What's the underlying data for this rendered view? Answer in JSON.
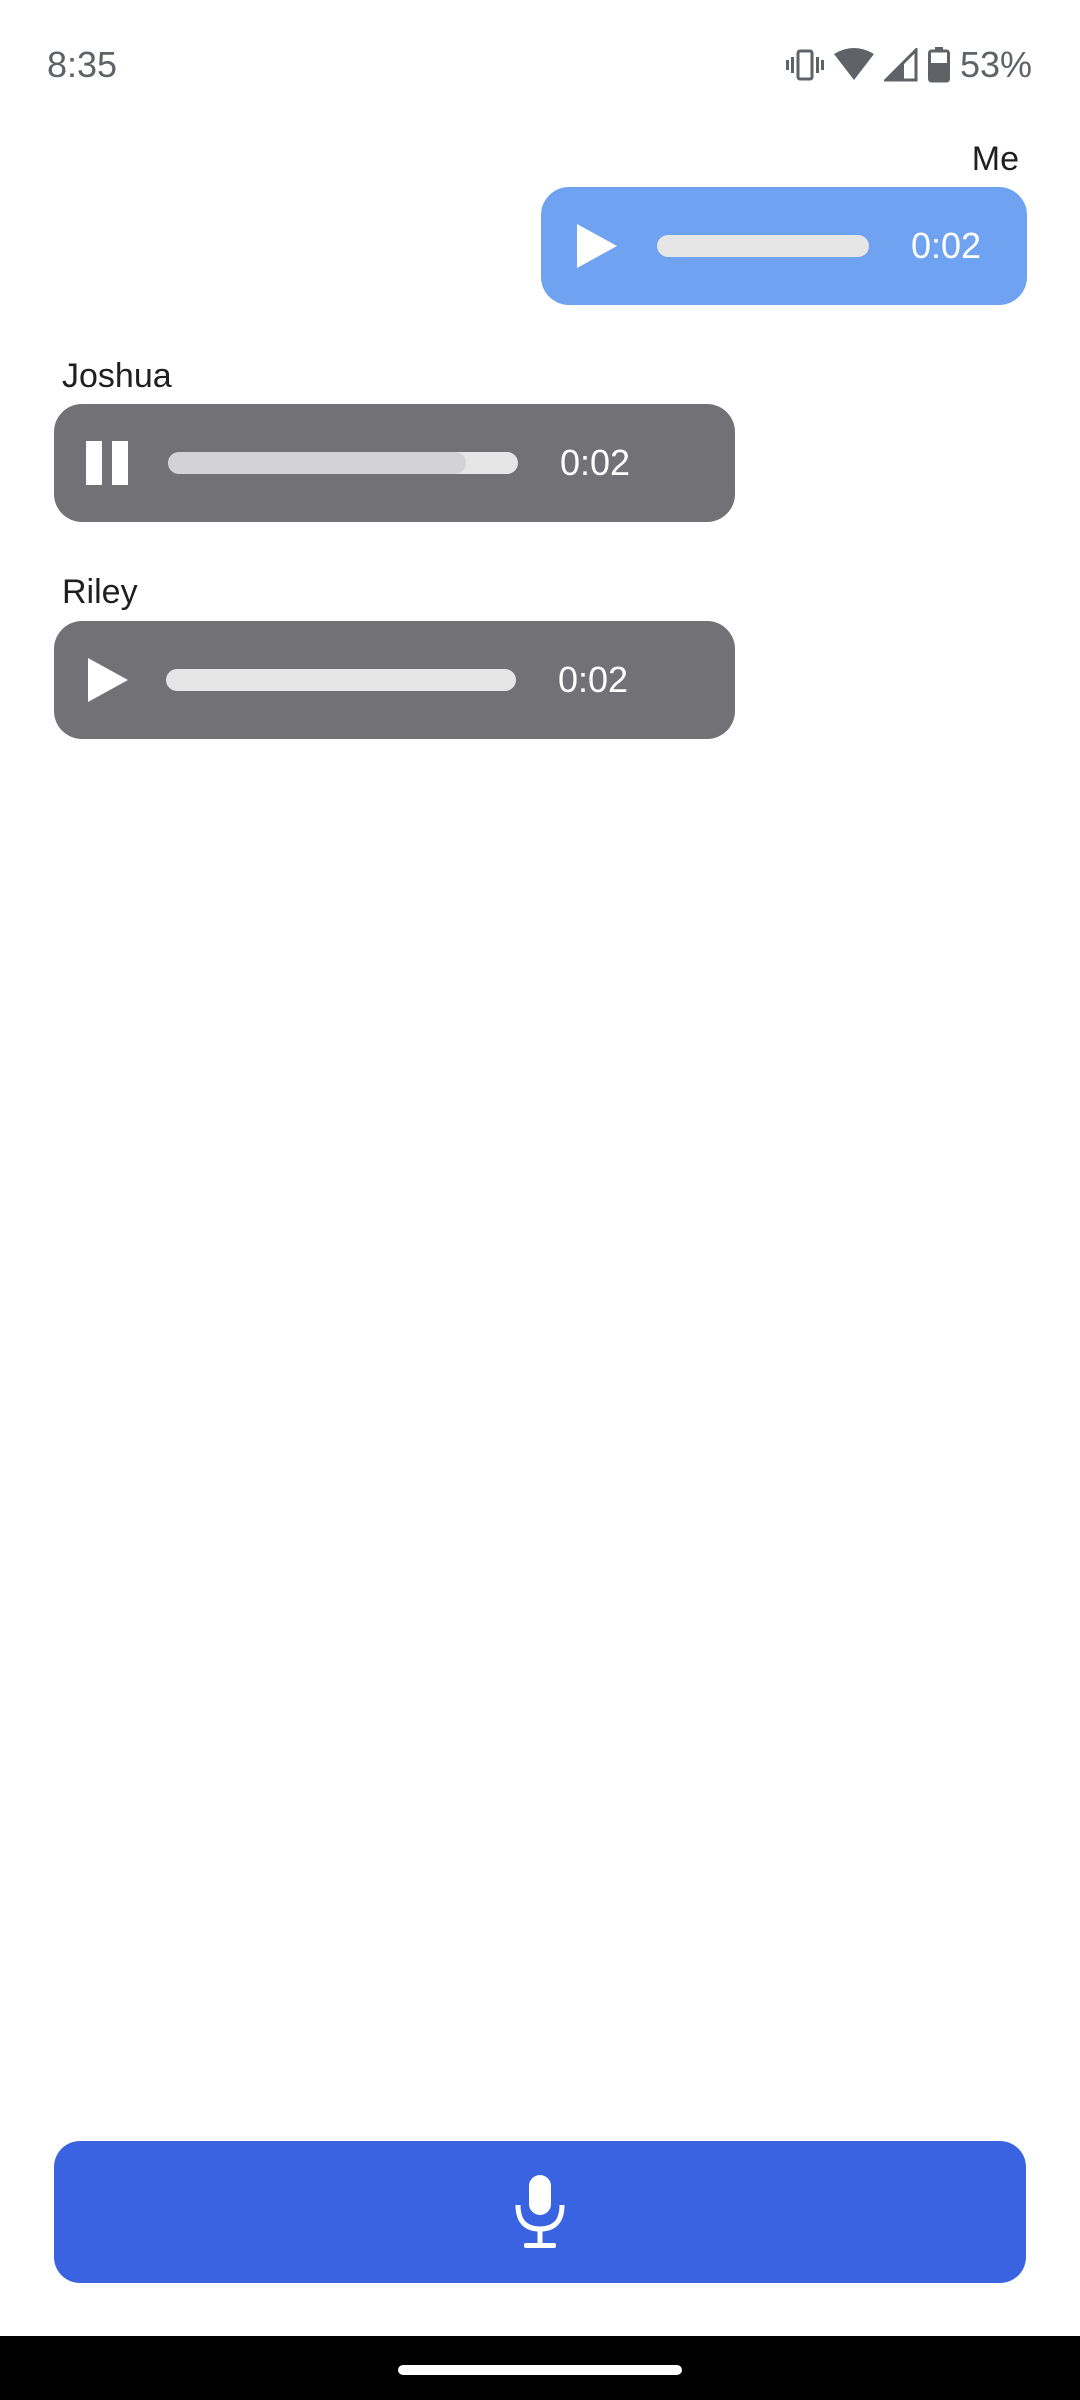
{
  "status_bar": {
    "time": "8:35",
    "battery": "53%",
    "icons": [
      "vibrate-icon",
      "wifi-icon",
      "signal-icon",
      "battery-icon"
    ]
  },
  "messages": [
    {
      "sender": "Me",
      "state": "paused",
      "duration": "0:02",
      "progress": 0
    },
    {
      "sender": "Joshua",
      "state": "playing",
      "duration": "0:02",
      "progress": 0.85
    },
    {
      "sender": "Riley",
      "state": "paused",
      "duration": "0:02",
      "progress": 0
    }
  ],
  "record_button": {
    "icon": "microphone-icon"
  },
  "colors": {
    "my_bubble": "#6fa2f0",
    "other_bubble": "#717176",
    "record_button": "#3a63e2"
  }
}
